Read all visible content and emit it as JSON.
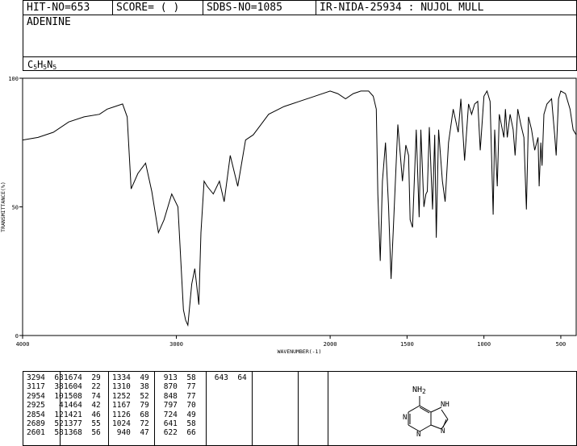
{
  "header": {
    "hit": "HIT-NO=653",
    "score": "SCORE=  (   )",
    "sdbs": "SDBS-NO=1085",
    "ir": "IR-NIDA-25934 : NUJOL MULL",
    "compound": "ADENINE",
    "formula_parts": [
      "C",
      "5",
      "H",
      "5",
      "N",
      "5"
    ]
  },
  "chart_data": {
    "type": "line",
    "xlabel": "WAVENUMBER(-1)",
    "ylabel": "TRANSMITTANCE(%)",
    "xlim": [
      4000,
      400
    ],
    "ylim": [
      0,
      100
    ],
    "x_ticks": [
      4000,
      3000,
      2000,
      1500,
      1000,
      500
    ],
    "y_ticks": [
      0,
      50,
      100
    ],
    "x": [
      4000,
      3900,
      3800,
      3700,
      3600,
      3500,
      3450,
      3400,
      3350,
      3320,
      3294,
      3250,
      3200,
      3160,
      3117,
      3080,
      3030,
      2990,
      2954,
      2940,
      2925,
      2900,
      2880,
      2854,
      2840,
      2820,
      2800,
      2760,
      2720,
      2689,
      2650,
      2601,
      2550,
      2500,
      2450,
      2400,
      2300,
      2200,
      2100,
      2000,
      1950,
      1900,
      1850,
      1800,
      1750,
      1720,
      1700,
      1690,
      1674,
      1660,
      1640,
      1620,
      1604,
      1590,
      1560,
      1530,
      1508,
      1490,
      1480,
      1464,
      1440,
      1421,
      1410,
      1390,
      1377,
      1368,
      1355,
      1334,
      1320,
      1310,
      1295,
      1270,
      1252,
      1230,
      1200,
      1167,
      1150,
      1126,
      1100,
      1080,
      1060,
      1040,
      1024,
      1000,
      980,
      960,
      940,
      930,
      913,
      900,
      880,
      870,
      860,
      848,
      830,
      810,
      797,
      780,
      760,
      740,
      724,
      710,
      690,
      670,
      648,
      641,
      630,
      622,
      610,
      590,
      560,
      540,
      530,
      515,
      500,
      470,
      440,
      420,
      400
    ],
    "y": [
      76,
      77,
      79,
      83,
      85,
      86,
      88,
      89,
      90,
      85,
      57,
      63,
      67,
      56,
      40,
      45,
      55,
      50,
      10,
      6,
      4,
      20,
      26,
      12,
      40,
      60,
      58,
      55,
      60,
      52,
      70,
      58,
      76,
      78,
      82,
      86,
      89,
      91,
      93,
      95,
      94,
      92,
      94,
      95,
      95,
      93,
      88,
      55,
      29,
      60,
      75,
      50,
      22,
      40,
      82,
      60,
      74,
      70,
      45,
      42,
      80,
      46,
      80,
      50,
      55,
      56,
      81,
      49,
      78,
      38,
      80,
      60,
      52,
      75,
      88,
      79,
      92,
      68,
      90,
      86,
      90,
      91,
      72,
      93,
      95,
      91,
      47,
      80,
      58,
      86,
      80,
      77,
      88,
      77,
      86,
      80,
      70,
      88,
      82,
      77,
      49,
      85,
      80,
      72,
      77,
      58,
      75,
      66,
      86,
      90,
      92,
      78,
      70,
      92,
      95,
      94,
      88,
      80,
      78
    ]
  },
  "peaks": [
    [
      "3294",
      "63"
    ],
    [
      "3117",
      "38"
    ],
    [
      "2954",
      "10"
    ],
    [
      "2925",
      "4"
    ],
    [
      "2854",
      "12"
    ],
    [
      "2689",
      "52"
    ],
    [
      "2601",
      "58"
    ],
    [
      "1674",
      "29"
    ],
    [
      "1604",
      "22"
    ],
    [
      "1508",
      "74"
    ],
    [
      "1464",
      "42"
    ],
    [
      "1421",
      "46"
    ],
    [
      "1377",
      "55"
    ],
    [
      "1368",
      "56"
    ],
    [
      "1334",
      "49"
    ],
    [
      "1310",
      "38"
    ],
    [
      "1252",
      "52"
    ],
    [
      "1167",
      "79"
    ],
    [
      "1126",
      "68"
    ],
    [
      "1024",
      "72"
    ],
    [
      "940",
      "47"
    ],
    [
      "913",
      "58"
    ],
    [
      "870",
      "77"
    ],
    [
      "848",
      "77"
    ],
    [
      "797",
      "70"
    ],
    [
      "724",
      "49"
    ],
    [
      "641",
      "58"
    ],
    [
      "622",
      "66"
    ],
    [
      "643",
      "64"
    ]
  ],
  "structure": {
    "amine": "NH",
    "amine_sub": "2",
    "n_labels": [
      "N",
      "N",
      "NH",
      "N"
    ]
  }
}
